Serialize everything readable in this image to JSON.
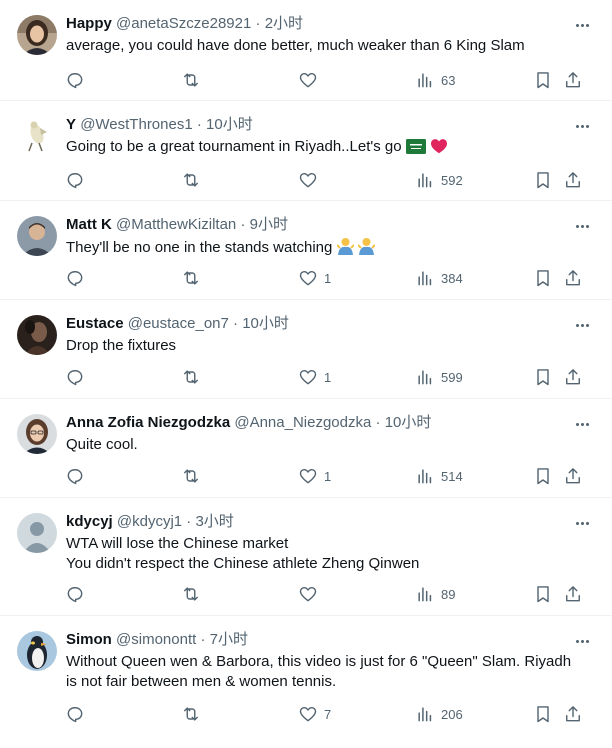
{
  "tweets": [
    {
      "name": "Happy",
      "handle": "@anetaSzcze28921",
      "time": "2小时",
      "lines": [
        "average, you could have done better, much weaker than 6 King Slam"
      ],
      "likes": "",
      "views": "63",
      "avatar": "woman-photo"
    },
    {
      "name": "Y",
      "handle": "@WestThrones1",
      "time": "10小时",
      "lines": [
        "Going to be a great tournament in Riyadh..Let's go"
      ],
      "emoji": [
        "saudi-flag",
        "red-heart"
      ],
      "likes": "",
      "views": "592",
      "avatar": "bird-figure"
    },
    {
      "name": "Matt K",
      "handle": "@MatthewKiziltan",
      "time": "9小时",
      "lines": [
        "They'll be no one in the stands watching"
      ],
      "emoji": [
        "man-shrugging",
        "man-shrugging"
      ],
      "likes": "1",
      "views": "384",
      "avatar": "man-photo"
    },
    {
      "name": "Eustace",
      "handle": "@eustace_on7",
      "time": "10小时",
      "lines": [
        "Drop the fixtures"
      ],
      "likes": "1",
      "views": "599",
      "avatar": "dark-photo"
    },
    {
      "name": "Anna Zofia Niezgodzka",
      "handle": "@Anna_Niezgodzka",
      "time": "10小时",
      "lines": [
        "Quite cool."
      ],
      "likes": "1",
      "views": "514",
      "avatar": "woman-glasses-photo"
    },
    {
      "name": "kdycyj",
      "handle": "@kdycyj1",
      "time": "3小时",
      "lines": [
        "WTA will lose the Chinese market",
        "You didn't respect the Chinese athlete Zheng Qinwen"
      ],
      "likes": "",
      "views": "89",
      "avatar": "default-avatar"
    },
    {
      "name": "Simon",
      "handle": "@simonontt",
      "time": "7小时",
      "lines": [
        "Without Queen wen & Barbora, this video is just for 6 \"Queen\" Slam. Riyadh",
        "is not fair between men & women tennis."
      ],
      "likes": "7",
      "views": "206",
      "avatar": "penguin-photo"
    }
  ],
  "separator": "·",
  "icons": {
    "reply": "reply-icon",
    "retweet": "retweet-icon",
    "like": "heart-icon",
    "views": "views-icon",
    "bookmark": "bookmark-icon",
    "share": "share-icon",
    "more": "more-icon"
  },
  "colors": {
    "text": "#0f1419",
    "secondary": "#536471",
    "divider": "#eff3f4"
  }
}
